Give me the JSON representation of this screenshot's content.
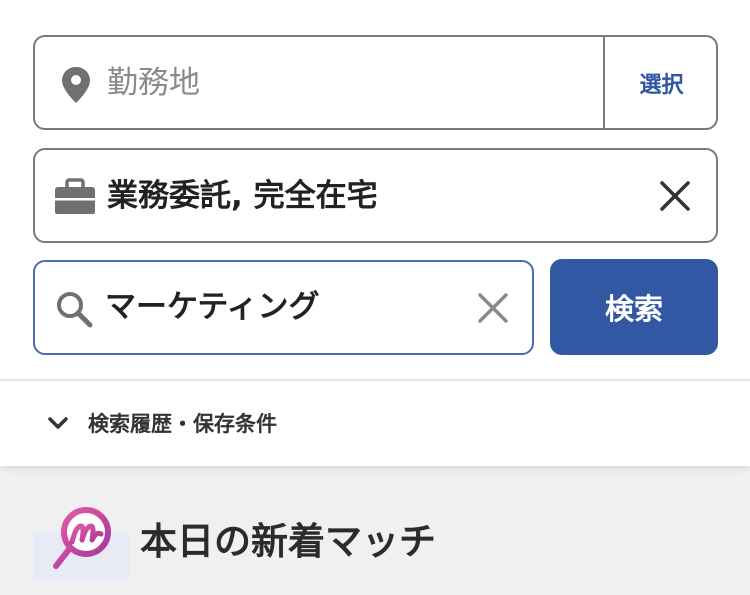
{
  "search": {
    "location": {
      "placeholder": "勤務地",
      "select_label": "選択",
      "icon": "map-pin-icon"
    },
    "employment_type": {
      "value": "業務委託, 完全在宅",
      "icon": "briefcase-icon",
      "clear_icon": "close-icon"
    },
    "keyword": {
      "value": "マーケティング",
      "icon": "search-icon",
      "clear_icon": "close-icon"
    },
    "submit_label": "検索"
  },
  "history": {
    "label": "検索履歴・保存条件",
    "icon": "chevron-down-icon"
  },
  "matches": {
    "title": "本日の新着マッチ",
    "icon": "match-logo-icon"
  },
  "colors": {
    "accent": "#3257a3",
    "select_text": "#2f55a4",
    "border": "#7a7a7a",
    "focus_border": "#4a6bb5",
    "logo_pink": "#d44c9a"
  }
}
